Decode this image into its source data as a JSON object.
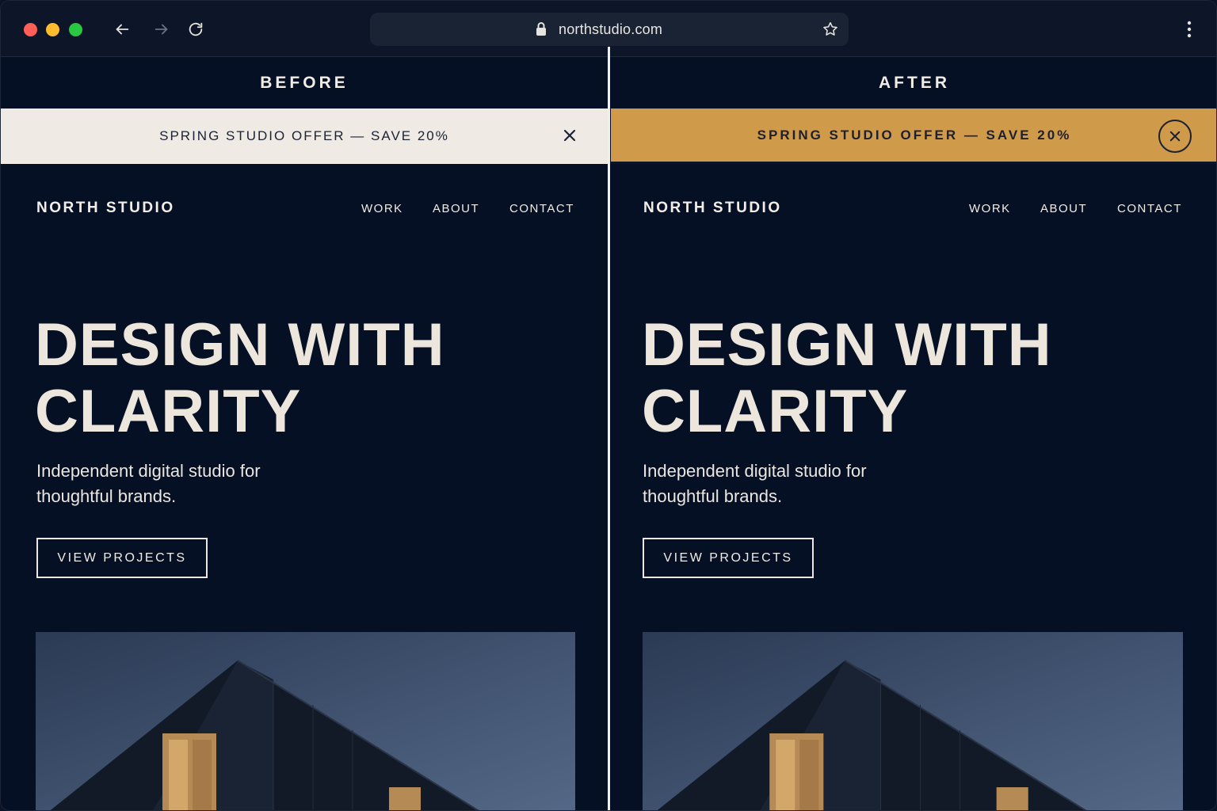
{
  "browser": {
    "url": "northstudio.com"
  },
  "panes": {
    "before": {
      "label": "BEFORE",
      "banner_text": "SPRING STUDIO OFFER — SAVE 20%"
    },
    "after": {
      "label": "AFTER",
      "banner_text": "SPRING STUDIO OFFER — SAVE 20%"
    }
  },
  "site": {
    "brand": "NORTH STUDIO",
    "nav": [
      "WORK",
      "ABOUT",
      "CONTACT"
    ],
    "hero_title_line1": "DESIGN WITH",
    "hero_title_line2": "CLARITY",
    "hero_subtitle": "Independent digital studio for thoughtful brands.",
    "cta_label": "VIEW PROJECTS"
  },
  "colors": {
    "page_bg": "#061024",
    "before_banner_bg": "#efebe4",
    "after_banner_bg": "#cf9a4a",
    "text_light": "#ece6dc"
  },
  "icons": {
    "back": "arrow-left-icon",
    "forward": "arrow-right-icon",
    "reload": "reload-icon",
    "lock": "lock-icon",
    "bookmark": "star-icon",
    "menu": "kebab-menu-icon",
    "close": "close-icon"
  }
}
